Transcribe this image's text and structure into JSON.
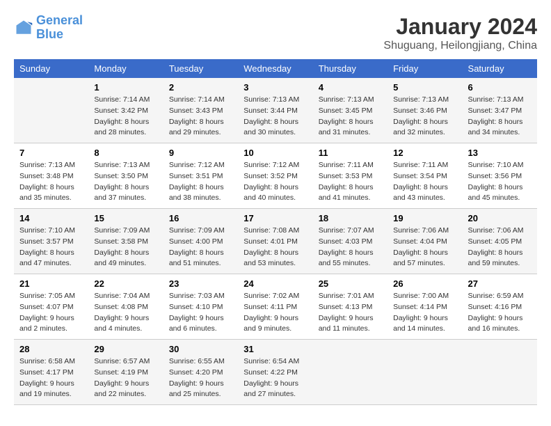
{
  "header": {
    "logo_line1": "General",
    "logo_line2": "Blue",
    "month_title": "January 2024",
    "subtitle": "Shuguang, Heilongjiang, China"
  },
  "days_of_week": [
    "Sunday",
    "Monday",
    "Tuesday",
    "Wednesday",
    "Thursday",
    "Friday",
    "Saturday"
  ],
  "weeks": [
    [
      {
        "day": "",
        "sunrise": "",
        "sunset": "",
        "daylight": ""
      },
      {
        "day": "1",
        "sunrise": "Sunrise: 7:14 AM",
        "sunset": "Sunset: 3:42 PM",
        "daylight": "Daylight: 8 hours and 28 minutes."
      },
      {
        "day": "2",
        "sunrise": "Sunrise: 7:14 AM",
        "sunset": "Sunset: 3:43 PM",
        "daylight": "Daylight: 8 hours and 29 minutes."
      },
      {
        "day": "3",
        "sunrise": "Sunrise: 7:13 AM",
        "sunset": "Sunset: 3:44 PM",
        "daylight": "Daylight: 8 hours and 30 minutes."
      },
      {
        "day": "4",
        "sunrise": "Sunrise: 7:13 AM",
        "sunset": "Sunset: 3:45 PM",
        "daylight": "Daylight: 8 hours and 31 minutes."
      },
      {
        "day": "5",
        "sunrise": "Sunrise: 7:13 AM",
        "sunset": "Sunset: 3:46 PM",
        "daylight": "Daylight: 8 hours and 32 minutes."
      },
      {
        "day": "6",
        "sunrise": "Sunrise: 7:13 AM",
        "sunset": "Sunset: 3:47 PM",
        "daylight": "Daylight: 8 hours and 34 minutes."
      }
    ],
    [
      {
        "day": "7",
        "sunrise": "Sunrise: 7:13 AM",
        "sunset": "Sunset: 3:48 PM",
        "daylight": "Daylight: 8 hours and 35 minutes."
      },
      {
        "day": "8",
        "sunrise": "Sunrise: 7:13 AM",
        "sunset": "Sunset: 3:50 PM",
        "daylight": "Daylight: 8 hours and 37 minutes."
      },
      {
        "day": "9",
        "sunrise": "Sunrise: 7:12 AM",
        "sunset": "Sunset: 3:51 PM",
        "daylight": "Daylight: 8 hours and 38 minutes."
      },
      {
        "day": "10",
        "sunrise": "Sunrise: 7:12 AM",
        "sunset": "Sunset: 3:52 PM",
        "daylight": "Daylight: 8 hours and 40 minutes."
      },
      {
        "day": "11",
        "sunrise": "Sunrise: 7:11 AM",
        "sunset": "Sunset: 3:53 PM",
        "daylight": "Daylight: 8 hours and 41 minutes."
      },
      {
        "day": "12",
        "sunrise": "Sunrise: 7:11 AM",
        "sunset": "Sunset: 3:54 PM",
        "daylight": "Daylight: 8 hours and 43 minutes."
      },
      {
        "day": "13",
        "sunrise": "Sunrise: 7:10 AM",
        "sunset": "Sunset: 3:56 PM",
        "daylight": "Daylight: 8 hours and 45 minutes."
      }
    ],
    [
      {
        "day": "14",
        "sunrise": "Sunrise: 7:10 AM",
        "sunset": "Sunset: 3:57 PM",
        "daylight": "Daylight: 8 hours and 47 minutes."
      },
      {
        "day": "15",
        "sunrise": "Sunrise: 7:09 AM",
        "sunset": "Sunset: 3:58 PM",
        "daylight": "Daylight: 8 hours and 49 minutes."
      },
      {
        "day": "16",
        "sunrise": "Sunrise: 7:09 AM",
        "sunset": "Sunset: 4:00 PM",
        "daylight": "Daylight: 8 hours and 51 minutes."
      },
      {
        "day": "17",
        "sunrise": "Sunrise: 7:08 AM",
        "sunset": "Sunset: 4:01 PM",
        "daylight": "Daylight: 8 hours and 53 minutes."
      },
      {
        "day": "18",
        "sunrise": "Sunrise: 7:07 AM",
        "sunset": "Sunset: 4:03 PM",
        "daylight": "Daylight: 8 hours and 55 minutes."
      },
      {
        "day": "19",
        "sunrise": "Sunrise: 7:06 AM",
        "sunset": "Sunset: 4:04 PM",
        "daylight": "Daylight: 8 hours and 57 minutes."
      },
      {
        "day": "20",
        "sunrise": "Sunrise: 7:06 AM",
        "sunset": "Sunset: 4:05 PM",
        "daylight": "Daylight: 8 hours and 59 minutes."
      }
    ],
    [
      {
        "day": "21",
        "sunrise": "Sunrise: 7:05 AM",
        "sunset": "Sunset: 4:07 PM",
        "daylight": "Daylight: 9 hours and 2 minutes."
      },
      {
        "day": "22",
        "sunrise": "Sunrise: 7:04 AM",
        "sunset": "Sunset: 4:08 PM",
        "daylight": "Daylight: 9 hours and 4 minutes."
      },
      {
        "day": "23",
        "sunrise": "Sunrise: 7:03 AM",
        "sunset": "Sunset: 4:10 PM",
        "daylight": "Daylight: 9 hours and 6 minutes."
      },
      {
        "day": "24",
        "sunrise": "Sunrise: 7:02 AM",
        "sunset": "Sunset: 4:11 PM",
        "daylight": "Daylight: 9 hours and 9 minutes."
      },
      {
        "day": "25",
        "sunrise": "Sunrise: 7:01 AM",
        "sunset": "Sunset: 4:13 PM",
        "daylight": "Daylight: 9 hours and 11 minutes."
      },
      {
        "day": "26",
        "sunrise": "Sunrise: 7:00 AM",
        "sunset": "Sunset: 4:14 PM",
        "daylight": "Daylight: 9 hours and 14 minutes."
      },
      {
        "day": "27",
        "sunrise": "Sunrise: 6:59 AM",
        "sunset": "Sunset: 4:16 PM",
        "daylight": "Daylight: 9 hours and 16 minutes."
      }
    ],
    [
      {
        "day": "28",
        "sunrise": "Sunrise: 6:58 AM",
        "sunset": "Sunset: 4:17 PM",
        "daylight": "Daylight: 9 hours and 19 minutes."
      },
      {
        "day": "29",
        "sunrise": "Sunrise: 6:57 AM",
        "sunset": "Sunset: 4:19 PM",
        "daylight": "Daylight: 9 hours and 22 minutes."
      },
      {
        "day": "30",
        "sunrise": "Sunrise: 6:55 AM",
        "sunset": "Sunset: 4:20 PM",
        "daylight": "Daylight: 9 hours and 25 minutes."
      },
      {
        "day": "31",
        "sunrise": "Sunrise: 6:54 AM",
        "sunset": "Sunset: 4:22 PM",
        "daylight": "Daylight: 9 hours and 27 minutes."
      },
      {
        "day": "",
        "sunrise": "",
        "sunset": "",
        "daylight": ""
      },
      {
        "day": "",
        "sunrise": "",
        "sunset": "",
        "daylight": ""
      },
      {
        "day": "",
        "sunrise": "",
        "sunset": "",
        "daylight": ""
      }
    ]
  ]
}
